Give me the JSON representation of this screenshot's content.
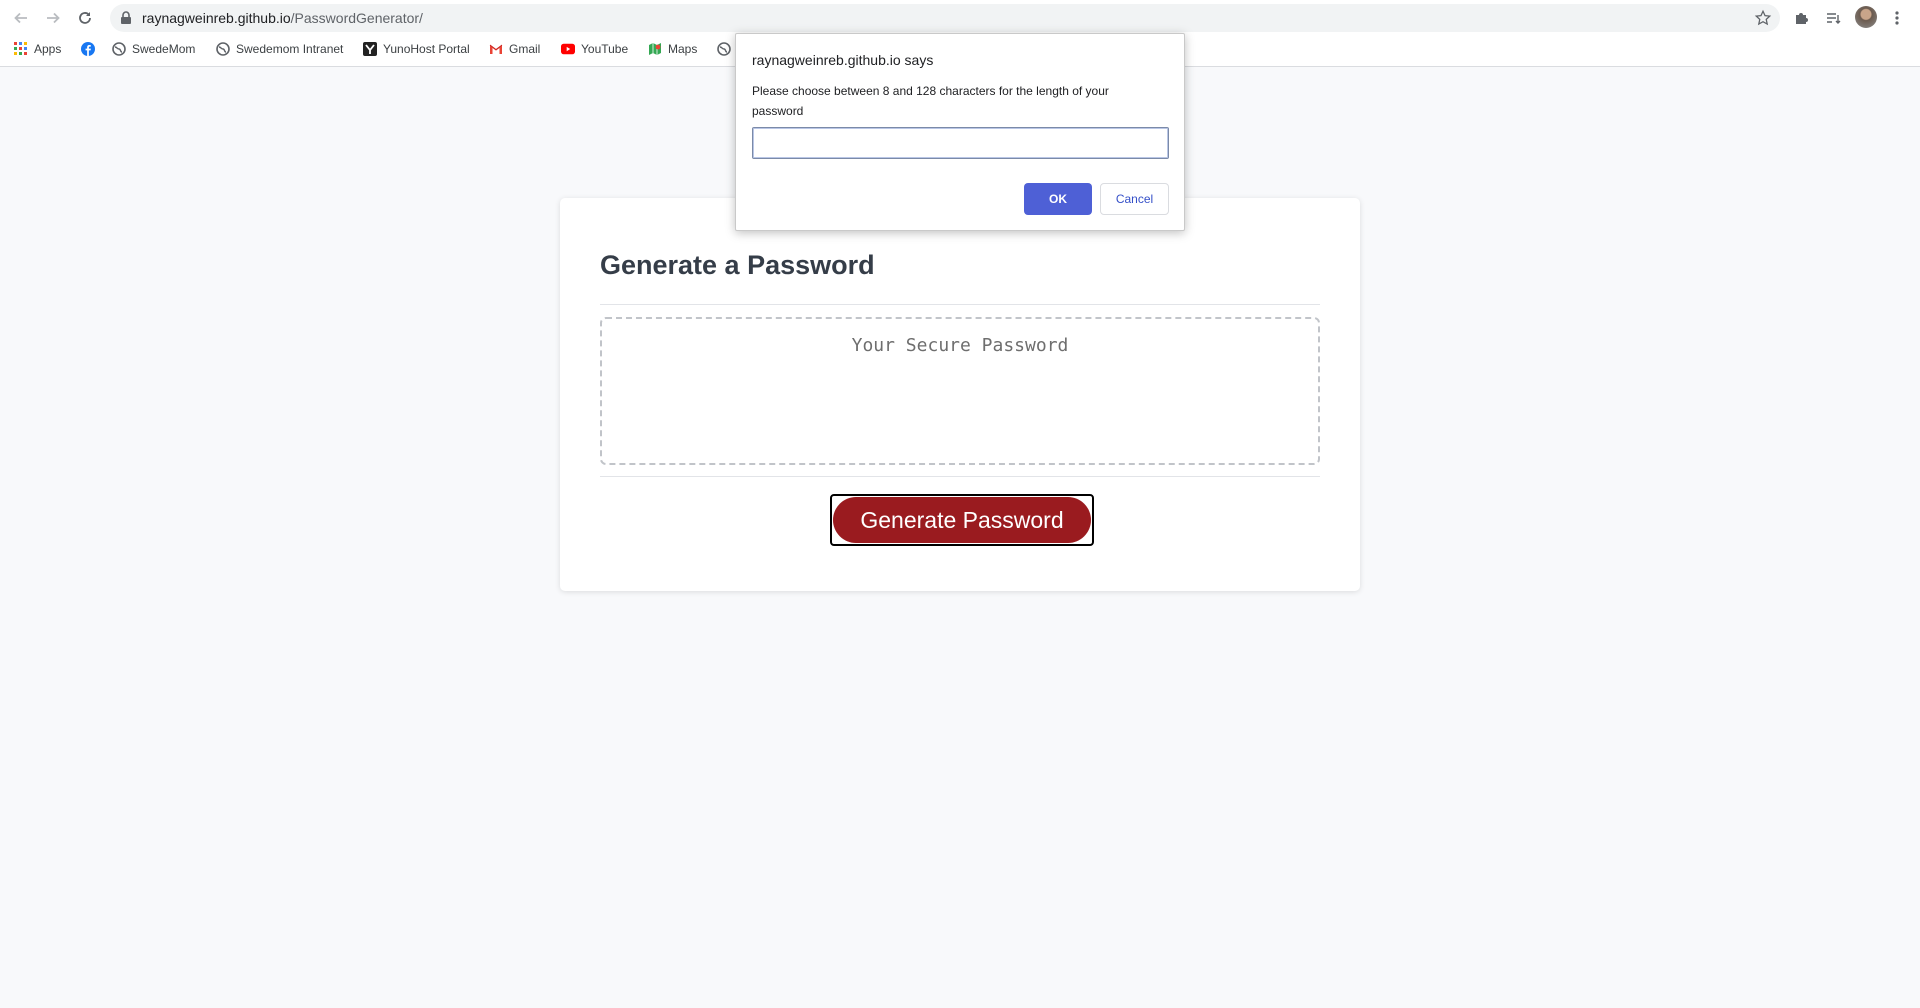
{
  "browser": {
    "url_host": "raynagweinreb.github.io",
    "url_path": "/PasswordGenerator/"
  },
  "bookmarks": [
    {
      "label": "Apps",
      "icon": "apps-grid-icon"
    },
    {
      "label": "",
      "icon": "facebook-icon"
    },
    {
      "label": "SwedeMom",
      "icon": "globe-icon"
    },
    {
      "label": "Swedemom Intranet",
      "icon": "globe-icon"
    },
    {
      "label": "YunoHost Portal",
      "icon": "yunohost-icon"
    },
    {
      "label": "Gmail",
      "icon": "gmail-icon"
    },
    {
      "label": "YouTube",
      "icon": "youtube-icon"
    },
    {
      "label": "Maps",
      "icon": "maps-icon"
    },
    {
      "label": "",
      "icon": "globe-icon"
    }
  ],
  "page": {
    "title": "Generate a Password",
    "password_placeholder": "Your Secure Password",
    "generate_label": "Generate Password"
  },
  "dialog": {
    "origin": "raynagweinreb.github.io says",
    "message": "Please choose between 8 and 128 characters for the length of your password",
    "input_value": "",
    "ok_label": "OK",
    "cancel_label": "Cancel"
  },
  "colors": {
    "generate_button": "#9a1b1f",
    "ok_button": "#4e60d6"
  }
}
